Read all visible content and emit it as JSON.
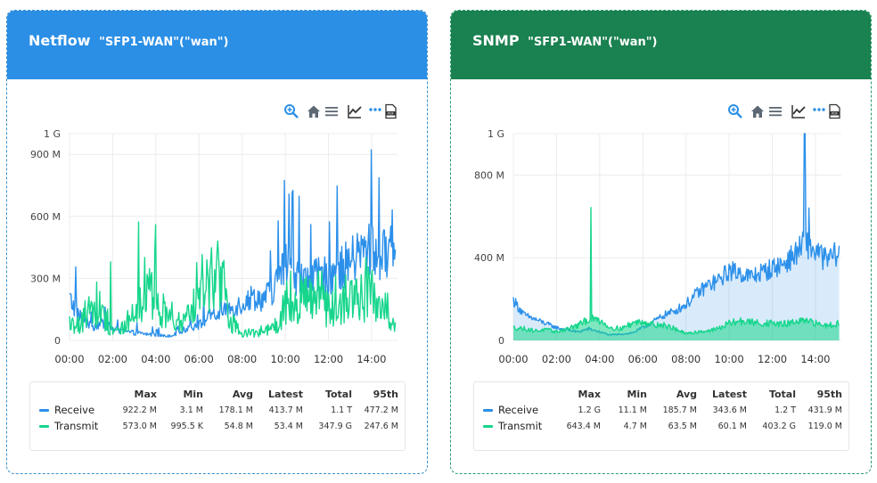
{
  "panels": [
    {
      "title": "Netflow",
      "subtitle": "\"SFP1-WAN\"(\"wan\")",
      "toolbar": [
        {
          "icon": "zoom-in-icon"
        },
        {
          "icon": "home-icon"
        },
        {
          "icon": "menu-icon"
        },
        {
          "icon": "line-chart-icon"
        },
        {
          "icon": "more-dots-icon"
        },
        {
          "icon": "pdf-icon"
        }
      ],
      "chart_data": {
        "type": "line",
        "x_labels": [
          "00:00",
          "02:00",
          "04:00",
          "06:00",
          "08:00",
          "10:00",
          "12:00",
          "14:00"
        ],
        "y_ticks": [
          "0",
          "300 M",
          "600 M",
          "900 M",
          "1 G"
        ],
        "y_values": [
          0,
          300,
          600,
          900,
          1000
        ],
        "ylim": [
          0,
          1000
        ],
        "xlim_hours": [
          0,
          15.2
        ],
        "grid": true,
        "series": [
          {
            "name": "Receive",
            "color": "#2c90ea",
            "hours": [
              0,
              0.5,
              1,
              1.5,
              2,
              2.5,
              3,
              3.5,
              4,
              4.5,
              5,
              5.5,
              6,
              6.5,
              7,
              7.5,
              8,
              8.5,
              9,
              9.5,
              10,
              10.5,
              11,
              11.5,
              12,
              12.5,
              13,
              13.5,
              14,
              14.5,
              15
            ],
            "values": [
              190,
              110,
              60,
              80,
              55,
              40,
              35,
              30,
              25,
              20,
              30,
              60,
              70,
              110,
              120,
              150,
              170,
              200,
              190,
              240,
              350,
              300,
              260,
              290,
              300,
              320,
              360,
              400,
              420,
              380,
              470
            ],
            "spike_hours": [
              14.0
            ],
            "spike_values": [
              922
            ]
          },
          {
            "name": "Transmit",
            "color": "#17d68c",
            "hours": [
              0,
              0.5,
              1,
              1.5,
              2,
              2.5,
              3,
              3.5,
              4,
              4.5,
              5,
              5.5,
              6,
              6.5,
              7,
              7.5,
              8,
              8.5,
              9,
              9.5,
              10,
              10.5,
              11,
              11.5,
              12,
              12.5,
              13,
              13.5,
              14,
              14.5,
              15
            ],
            "values": [
              45,
              70,
              150,
              110,
              40,
              60,
              80,
              200,
              180,
              100,
              60,
              90,
              200,
              260,
              240,
              80,
              30,
              30,
              40,
              50,
              120,
              160,
              180,
              200,
              130,
              140,
              180,
              200,
              160,
              120,
              60
            ],
            "spike_hours": [
              3.2,
              4.0,
              1.9
            ],
            "spike_values": [
              573,
              560,
              380
            ]
          }
        ]
      },
      "legend": {
        "headers": [
          "Max",
          "Min",
          "Avg",
          "Latest",
          "Total",
          "95th"
        ],
        "rows": [
          {
            "name": "Receive",
            "color": "#2c90ea",
            "values": [
              "922.2 M",
              "3.1 M",
              "178.1 M",
              "413.7 M",
              "1.1 T",
              "477.2 M"
            ]
          },
          {
            "name": "Transmit",
            "color": "#17d68c",
            "values": [
              "573.0 M",
              "995.5 K",
              "54.8 M",
              "53.4 M",
              "347.9 G",
              "247.6 M"
            ]
          }
        ]
      }
    },
    {
      "title": "SNMP",
      "subtitle": "\"SFP1-WAN\"(\"wan\")",
      "toolbar": [
        {
          "icon": "zoom-in-icon"
        },
        {
          "icon": "home-icon"
        },
        {
          "icon": "menu-icon"
        },
        {
          "icon": "line-chart-icon"
        },
        {
          "icon": "more-dots-icon"
        },
        {
          "icon": "pdf-icon"
        }
      ],
      "chart_data": {
        "type": "area",
        "x_labels": [
          "00:00",
          "02:00",
          "04:00",
          "06:00",
          "08:00",
          "10:00",
          "12:00",
          "14:00"
        ],
        "y_ticks": [
          "0",
          "400 M",
          "800 M",
          "1 G"
        ],
        "y_values": [
          0,
          400,
          800,
          1000
        ],
        "ylim": [
          0,
          1000
        ],
        "xlim_hours": [
          0,
          15.2
        ],
        "grid": true,
        "series": [
          {
            "name": "Receive",
            "color": "#2c90ea",
            "hours": [
              0,
              0.5,
              1,
              1.5,
              2,
              2.5,
              3,
              3.5,
              4,
              4.5,
              5,
              5.5,
              6,
              6.5,
              7,
              7.5,
              8,
              8.5,
              9,
              9.5,
              10,
              10.5,
              11,
              11.5,
              12,
              12.5,
              13,
              13.5,
              14,
              14.5,
              15
            ],
            "values": [
              190,
              120,
              100,
              80,
              60,
              50,
              40,
              55,
              40,
              25,
              30,
              35,
              60,
              90,
              120,
              140,
              170,
              220,
              260,
              280,
              330,
              320,
              300,
              320,
              340,
              360,
              400,
              460,
              420,
              380,
              410
            ],
            "spike_hours": [
              13.5,
              13.7
            ],
            "spike_values": [
              1180,
              640
            ]
          },
          {
            "name": "Transmit",
            "color": "#17d68c",
            "hours": [
              0,
              0.5,
              1,
              1.5,
              2,
              2.5,
              3,
              3.5,
              4,
              4.5,
              5,
              5.5,
              6,
              6.5,
              7,
              7.5,
              8,
              8.5,
              9,
              9.5,
              10,
              10.5,
              11,
              11.5,
              12,
              12.5,
              13,
              13.5,
              14,
              14.5,
              15
            ],
            "values": [
              60,
              55,
              45,
              50,
              40,
              55,
              70,
              100,
              95,
              60,
              55,
              80,
              90,
              75,
              70,
              55,
              30,
              40,
              45,
              55,
              80,
              90,
              85,
              80,
              80,
              75,
              85,
              90,
              80,
              70,
              80
            ],
            "spike_hours": [
              3.6
            ],
            "spike_values": [
              643
            ]
          }
        ]
      },
      "legend": {
        "headers": [
          "Max",
          "Min",
          "Avg",
          "Latest",
          "Total",
          "95th"
        ],
        "rows": [
          {
            "name": "Receive",
            "color": "#2c90ea",
            "values": [
              "1.2 G",
              "11.1 M",
              "185.7 M",
              "343.6 M",
              "1.2 T",
              "431.9 M"
            ]
          },
          {
            "name": "Transmit",
            "color": "#17d68c",
            "values": [
              "643.4 M",
              "4.7 M",
              "63.5 M",
              "60.1 M",
              "403.2 G",
              "119.0 M"
            ]
          }
        ]
      }
    }
  ]
}
